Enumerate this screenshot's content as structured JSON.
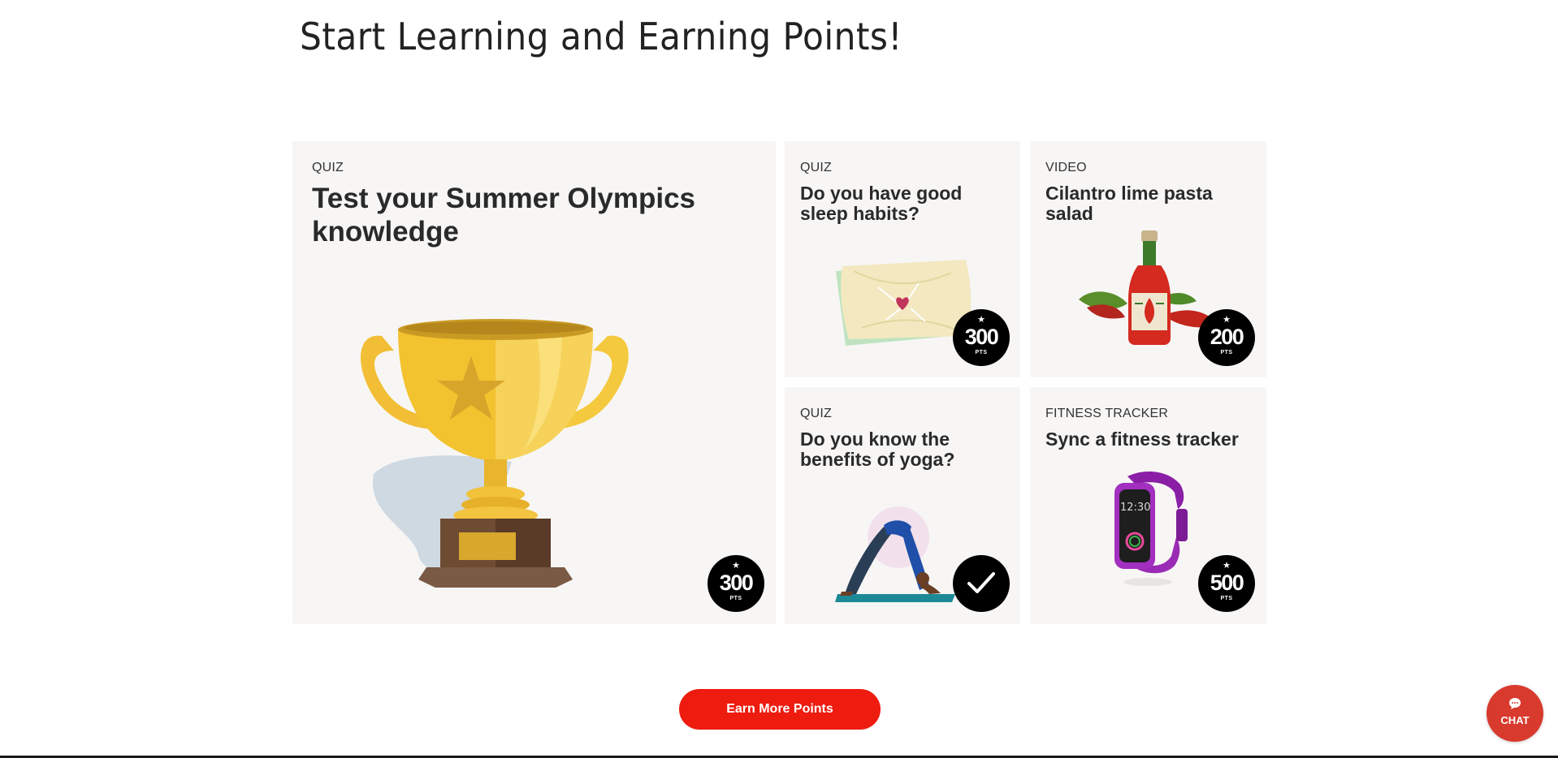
{
  "page": {
    "title": "Start Learning and Earning Points!"
  },
  "cards": [
    {
      "type": "QUIZ",
      "title": "Test your Summer Olympics knowledge",
      "image": "trophy-illustration",
      "badge": {
        "star": "★",
        "value": "300",
        "unit": "PTS",
        "completed": false
      }
    },
    {
      "type": "QUIZ",
      "title": "Do you have good sleep habits?",
      "image": "pillow-illustration",
      "badge": {
        "star": "★",
        "value": "300",
        "unit": "PTS",
        "completed": false
      }
    },
    {
      "type": "VIDEO",
      "title": "Cilantro lime pasta salad",
      "image": "hot-sauce-illustration",
      "badge": {
        "star": "★",
        "value": "200",
        "unit": "PTS",
        "completed": false
      }
    },
    {
      "type": "QUIZ",
      "title": "Do you know the benefits of yoga?",
      "image": "yoga-pose-illustration",
      "badge": {
        "completed": true,
        "icon": "checkmark-icon"
      }
    },
    {
      "type": "FITNESS TRACKER",
      "title": "Sync a fitness tracker",
      "image": "fitness-band-illustration",
      "watch_time": "12:30",
      "badge": {
        "star": "★",
        "value": "500",
        "unit": "PTS",
        "completed": false
      }
    }
  ],
  "actions": {
    "earn_more": "Earn More Points"
  },
  "chat": {
    "label": "CHAT",
    "icon": "chat-bubble-icon"
  },
  "colors": {
    "card_background": "#f7f6f5",
    "primary_red": "#ee1b0f",
    "chat_red": "#d83a2d",
    "badge_black": "#000000"
  }
}
